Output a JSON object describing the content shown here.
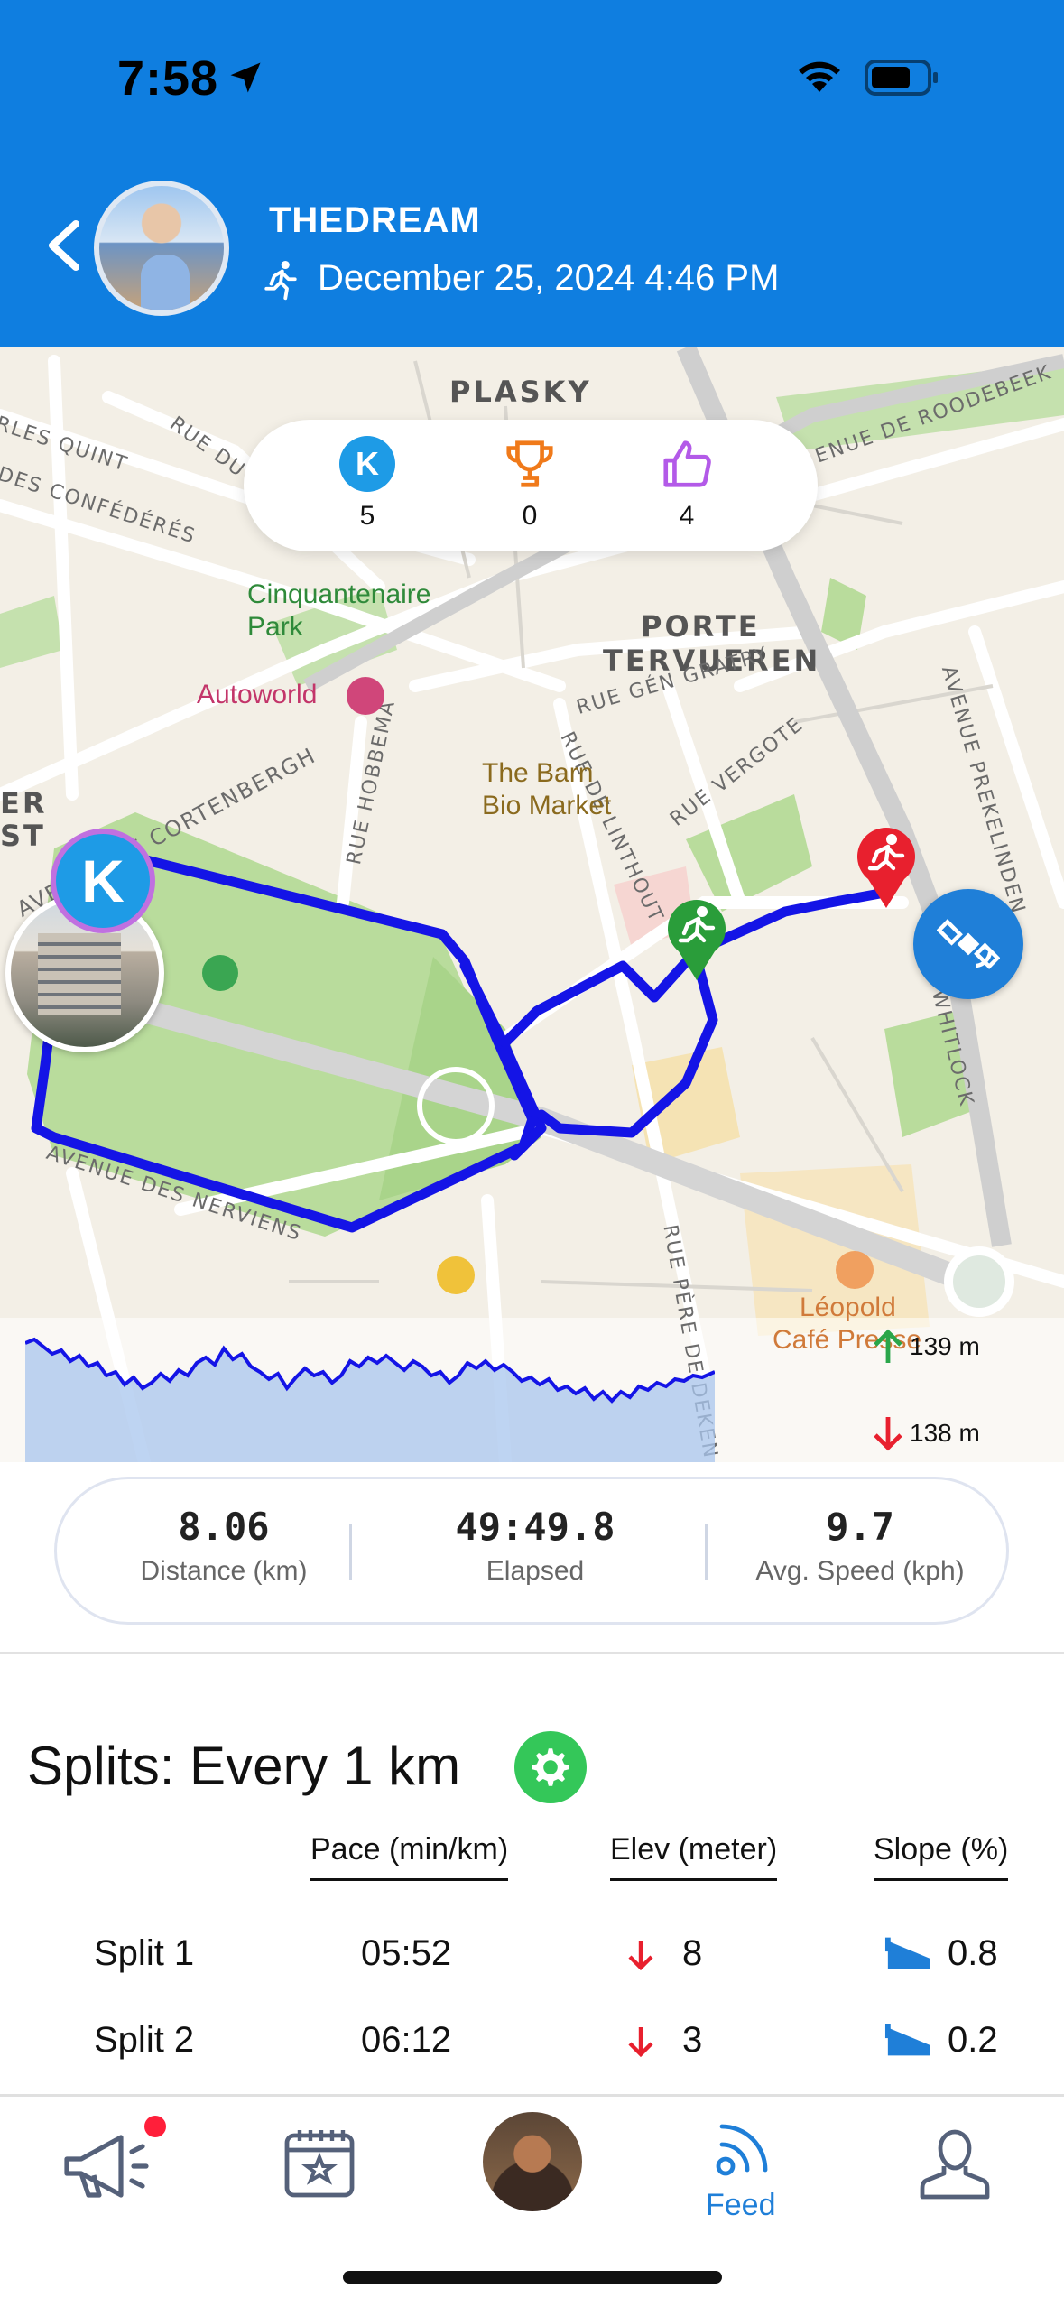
{
  "status_bar": {
    "time": "7:58"
  },
  "header": {
    "user_name": "THEDREAM",
    "date": "December 25, 2024 4:46 PM"
  },
  "map": {
    "labels": {
      "plasky": "PLASKY",
      "porte_tervueren_1": "PORTE",
      "porte_tervueren_2": "TERVUEREN",
      "rue_quint": "RLES QUINT",
      "rue_du_noyer": "RUE DU NOYER",
      "des_confederes": "DES CONFÉDÉRÉS",
      "ave_cortenbergh": "AVENUE DE CORTENBERGH",
      "rue_hobbema": "RUE HOBBEMA",
      "rue_gen_gratry": "RUE GÉN GRATRY",
      "rue_vergote": "RUE VERGOTE",
      "rue_de_linthout": "RUE DE LINTHOUT",
      "ave_roodebeek": "ENUE DE ROODEBEEK",
      "ave_prekelinden": "AVENUE PREKELINDEN",
      "ave_whitlock": "ND WHITLOCK",
      "ave_nerviens": "AVENUE DES NERVIENS",
      "rue_pere_de_deken": "RUE PÈRE DE DEKEN",
      "er_st": "ER",
      "st": "ST"
    },
    "pois": {
      "park_1": "Cinquantenaire",
      "park_2": "Park",
      "autoworld": "Autoworld",
      "barn_1": "The Barn",
      "barn_2": "Bio Market",
      "leopold_1": "Léopold",
      "leopold_2": "Café Presse"
    },
    "stats": {
      "k_label": "K",
      "k_count": "5",
      "trophies": "0",
      "likes": "4"
    },
    "k_marker": "K",
    "elevation": {
      "high": "139 m",
      "low": "138 m"
    }
  },
  "summary": {
    "distance": {
      "value": "8.06",
      "label": "Distance (km)"
    },
    "elapsed": {
      "value": "49:49.8",
      "label": "Elapsed"
    },
    "avg_speed": {
      "value": "9.7",
      "label": "Avg. Speed (kph)"
    }
  },
  "splits": {
    "title": "Splits: Every 1 km",
    "columns": {
      "pace": "Pace (min/km)",
      "elev": "Elev (meter)",
      "slope": "Slope (%)"
    },
    "rows": [
      {
        "name": "Split 1",
        "pace": "05:52",
        "elev": "8",
        "elev_dir": "down",
        "slope": "0.8"
      },
      {
        "name": "Split 2",
        "pace": "06:12",
        "elev": "3",
        "elev_dir": "down",
        "slope": "0.2"
      }
    ]
  },
  "tabbar": {
    "active": "feed",
    "feed_label": "Feed"
  },
  "colors": {
    "header_blue": "#0f7ee0",
    "route_blue": "#1414e6",
    "accent_blue": "#1f7fd8",
    "green": "#34c759",
    "red": "#ff1f3a"
  }
}
